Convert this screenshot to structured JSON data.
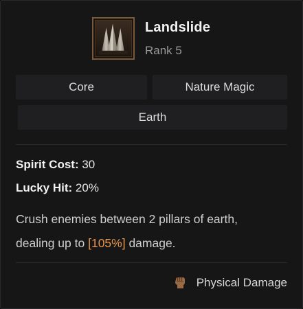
{
  "skill": {
    "name": "Landslide",
    "rank": "Rank 5",
    "icon": "earth-spikes-icon"
  },
  "tags": {
    "row1": [
      "Core",
      "Nature Magic"
    ],
    "row2": [
      "Earth"
    ]
  },
  "stats": {
    "spirit_cost_label": "Spirit Cost:",
    "spirit_cost_value": "30",
    "lucky_hit_label": "Lucky Hit:",
    "lucky_hit_value": "20%"
  },
  "description": {
    "line1": "Crush enemies between 2 pillars of earth,",
    "line2_before": "dealing up to ",
    "highlight": "[105%]",
    "line2_after": " damage."
  },
  "damage_type": {
    "label": "Physical Damage",
    "icon": "fist-icon"
  },
  "colors": {
    "highlight": "#e8944a",
    "frame": "#7a5a38",
    "panel": "#161617"
  }
}
